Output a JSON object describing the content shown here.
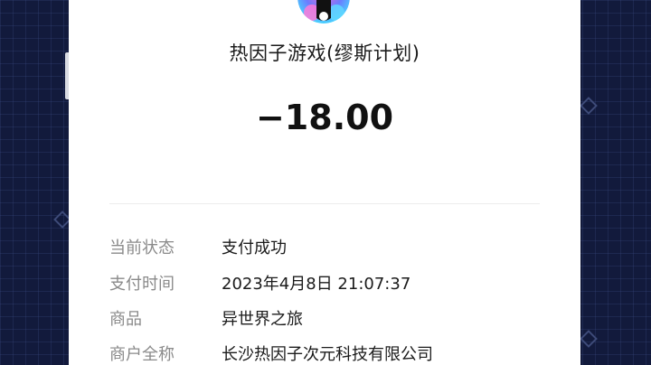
{
  "receipt": {
    "merchant_name": "热因子游戏(缪斯计划)",
    "amount": "−18.00",
    "details": [
      {
        "label": "当前状态",
        "value": "支付成功"
      },
      {
        "label": "支付时间",
        "value": "2023年4月8日 21:07:37"
      },
      {
        "label": "商品",
        "value": "异世界之旅"
      },
      {
        "label": "商户全称",
        "value": "长沙热因子次元科技有限公司"
      }
    ]
  },
  "colors": {
    "background": "#121a3c",
    "card": "#ffffff",
    "label": "#8a8a8a",
    "text": "#1b1b1b"
  },
  "icons": {
    "merchant_avatar": "merchant-logo-icon"
  }
}
